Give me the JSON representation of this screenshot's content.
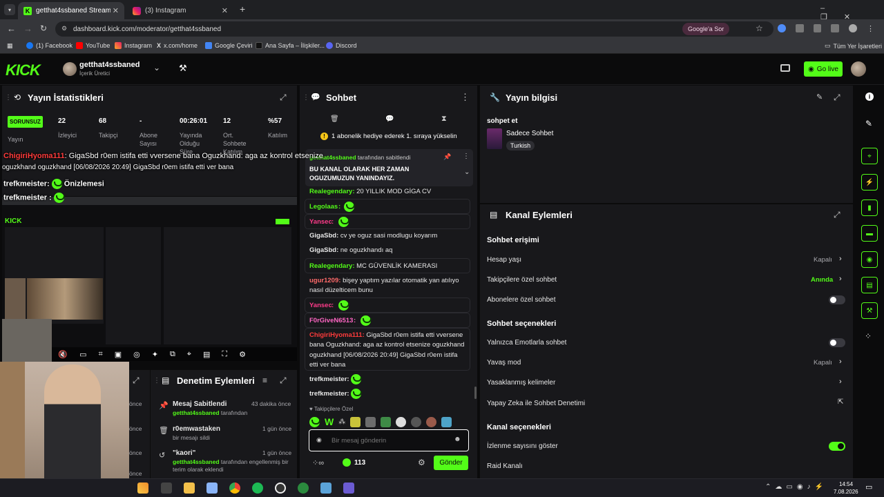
{
  "browser": {
    "tabs": [
      {
        "title": "getthat4ssbaned Stream - Kick",
        "close": "✕"
      },
      {
        "title": "(3) Instagram",
        "close": "✕"
      }
    ],
    "new_tab": "+",
    "url": "dashboard.kick.com/moderator/getthat4ssbaned",
    "google_ask": "Google'a Sor",
    "bookmarks": [
      "(1) Facebook",
      "YouTube",
      "Instagram",
      "x.com/home",
      "Google Çeviri",
      "Ana Sayfa – İlişkiler...",
      "Discord"
    ],
    "all_bookmarks": "Tüm Yer İşaretleri"
  },
  "header": {
    "logo": "KICK",
    "channel_name": "getthat4ssbaned",
    "channel_role": "İçerik Üretici",
    "go_live": "Go live"
  },
  "stats": {
    "title": "Yayın İstatistikleri",
    "status_badge": "SORUNSUZ",
    "items": [
      {
        "value": "22",
        "label": "İzleyici"
      },
      {
        "value": "68",
        "label": "Takipçi"
      },
      {
        "value": "-",
        "label": "Abone Sayısı"
      },
      {
        "value": "00:26:01",
        "label": "Yayında Olduğu Süre"
      },
      {
        "value": "12",
        "label": "Ort. Sohbete Katılım"
      },
      {
        "value": "%57",
        "label": "Katılım"
      }
    ],
    "stream_label": "Yayın"
  },
  "overlay": {
    "line1_user": "ChigiriHyoma111",
    "line1_text": ": GigaSbd r0em istifa etti vversene bana Oguzkhand: aga az kontrol etsenize",
    "line2_text": "oguzkhand oguzkhand [06/08/2026 20:49] GigaSbd r0em istifa etti ver bana",
    "line3_text": "trefkmeister: ",
    "line3_extra": "Önizlemesi",
    "line4_text": "trefkmeister : "
  },
  "chat": {
    "title": "Sohbet",
    "gift_banner": "1 abonelik hediye ederek 1. sıraya yükselin",
    "pinned_by": "getthat4ssbaned",
    "pinned_suffix": "tarafından sabitlendi",
    "pinned_text": "BU KANAL OLARAK HER ZAMAN OGUZUMUZUN YANINDAYIZ.",
    "messages": [
      {
        "user": "Realegendary",
        "text": "20 YILLIK MOD GİGA CV"
      },
      {
        "user": "Legolaas",
        "text": ""
      },
      {
        "user": "Yansec",
        "text": ""
      },
      {
        "user": "GigaSbd",
        "text": "cv ye oguz sasi modlugu koyarım"
      },
      {
        "user": "GigaSbd",
        "text": "ne oguzkhandı aq"
      },
      {
        "user": "Realegendary",
        "text": "MC GÜVENLİK KAMERASI"
      },
      {
        "user": "ugur1209",
        "text": "bişey yaptım yazılar otomatik yan atılıyo nasıl düzelticem bunu"
      },
      {
        "user": "Yansec",
        "text": ""
      },
      {
        "user": "F0rGiveN6513",
        "text": ""
      },
      {
        "user": "ChigiriHyoma111",
        "text": "GigaSbd r0em istifa etti vversene bana Oguzkhand: aga az kontrol etsenize oguzkhand oguzkhand [06/08/2026 20:49] GigaSbd r0em istifa etti ver bana"
      },
      {
        "user": "trefkmeister",
        "text": ""
      },
      {
        "user": "trefkmeister",
        "text": ""
      }
    ],
    "followers_only": "Takipçilere Özel",
    "input_placeholder": "Bir mesaj gönderin",
    "points": "113",
    "send": "Gönder"
  },
  "mod_actions": {
    "title": "Denetim Eylemleri",
    "items": [
      {
        "title": "Mesaj Sabitlendi",
        "user": "getthat4ssbaned",
        "desc": "tarafından",
        "time": "43 dakika önce"
      },
      {
        "title": "r0emwastaken",
        "user": "",
        "desc": "bir mesajı sildi",
        "time": "1 gün önce"
      },
      {
        "title": "\"kaori\"",
        "user": "getthat4ssbaned",
        "desc": "tarafından engellenmiş bir terim olarak eklendi",
        "time": "1 gün önce"
      }
    ],
    "left_times": [
      "önce",
      "önce",
      "önce",
      "önce"
    ]
  },
  "stream_info": {
    "title": "Yayın bilgisi",
    "stream_title": "sohpet et",
    "category": "Sadece Sohbet",
    "language": "Turkish"
  },
  "channel_actions": {
    "title": "Kanal Eylemleri",
    "chat_access": "Sohbet erişimi",
    "account_age": "Hesap yaşı",
    "account_age_val": "Kapalı",
    "followers_chat": "Takipçilere özel sohbet",
    "followers_chat_val": "Anında",
    "subs_chat": "Abonelere özel sohbet",
    "chat_options": "Sohbet seçenekleri",
    "emote_only": "Yalnızca Emotlarla sohbet",
    "slow_mode": "Yavaş mod",
    "slow_mode_val": "Kapalı",
    "banned_words": "Yasaklanmış kelimeler",
    "ai_moderation": "Yapay Zeka ile Sohbet Denetimi",
    "channel_options": "Kanal seçenekleri",
    "show_viewers": "İzlenme sayısını göster",
    "raid": "Raid Kanalı"
  },
  "taskbar": {
    "time": "14:54",
    "date": "7.08.2026"
  },
  "colors": {
    "accent": "#53fc18",
    "panel": "#18181b",
    "bg": "#0b0b0c"
  }
}
